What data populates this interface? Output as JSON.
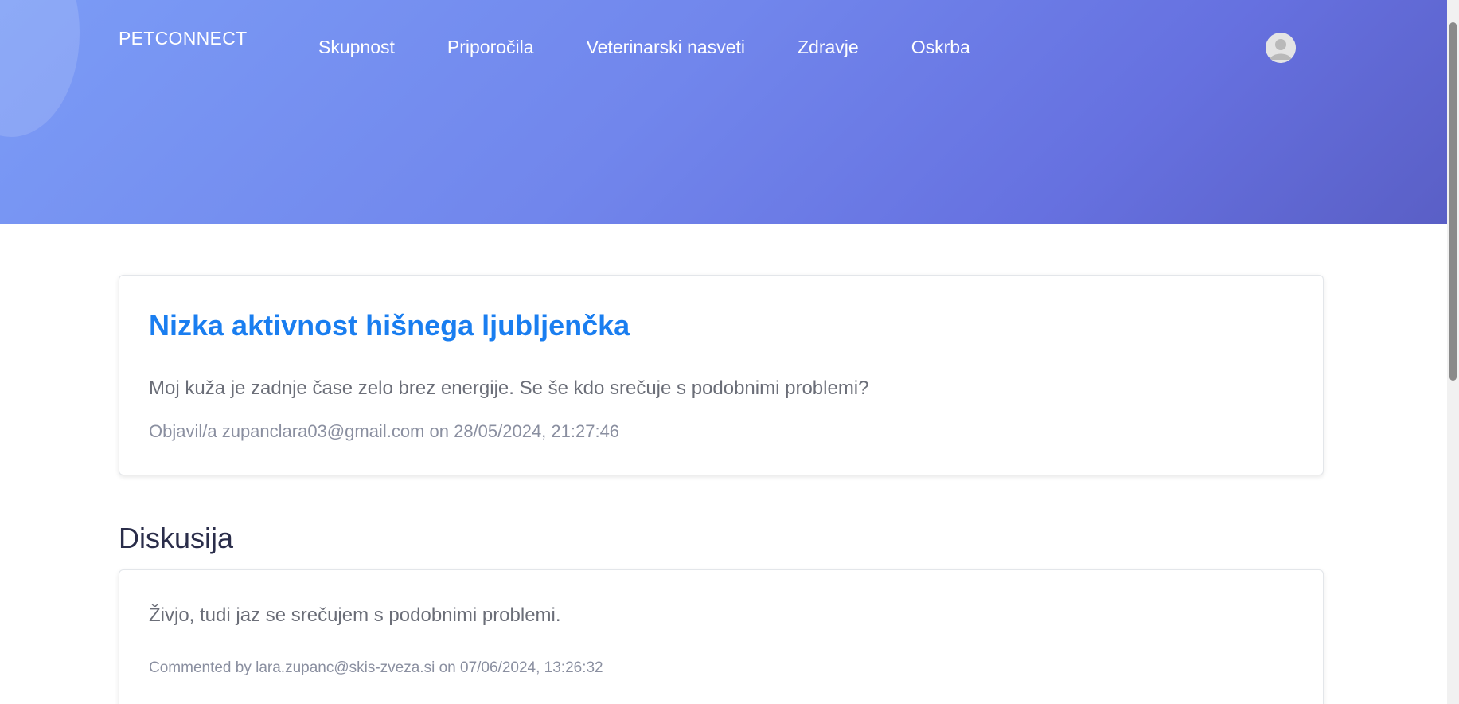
{
  "header": {
    "brand": "PETCONNECT",
    "nav": [
      {
        "label": "Skupnost"
      },
      {
        "label": "Priporočila"
      },
      {
        "label": "Veterinarski nasveti"
      },
      {
        "label": "Zdravje"
      },
      {
        "label": "Oskrba"
      }
    ],
    "avatar_icon": "user-avatar-icon"
  },
  "post": {
    "title": "Nizka aktivnost hišnega ljubljenčka",
    "body": "Moj kuža je zadnje čase zelo brez energije. Se še kdo srečuje s podobnimi problemi?",
    "meta": "Objavil/a zupanclara03@gmail.com on 28/05/2024, 21:27:46"
  },
  "discussion": {
    "title": "Diskusija",
    "comments": [
      {
        "body": "Živjo, tudi jaz se srečujem s podobnimi problemi.",
        "meta": "Commented by lara.zupanc@skis-zveza.si on 07/06/2024, 13:26:32"
      }
    ]
  },
  "colors": {
    "accent": "#1a7ef0",
    "hero_start": "#7b9cf6",
    "hero_end": "#5a5fc6"
  }
}
